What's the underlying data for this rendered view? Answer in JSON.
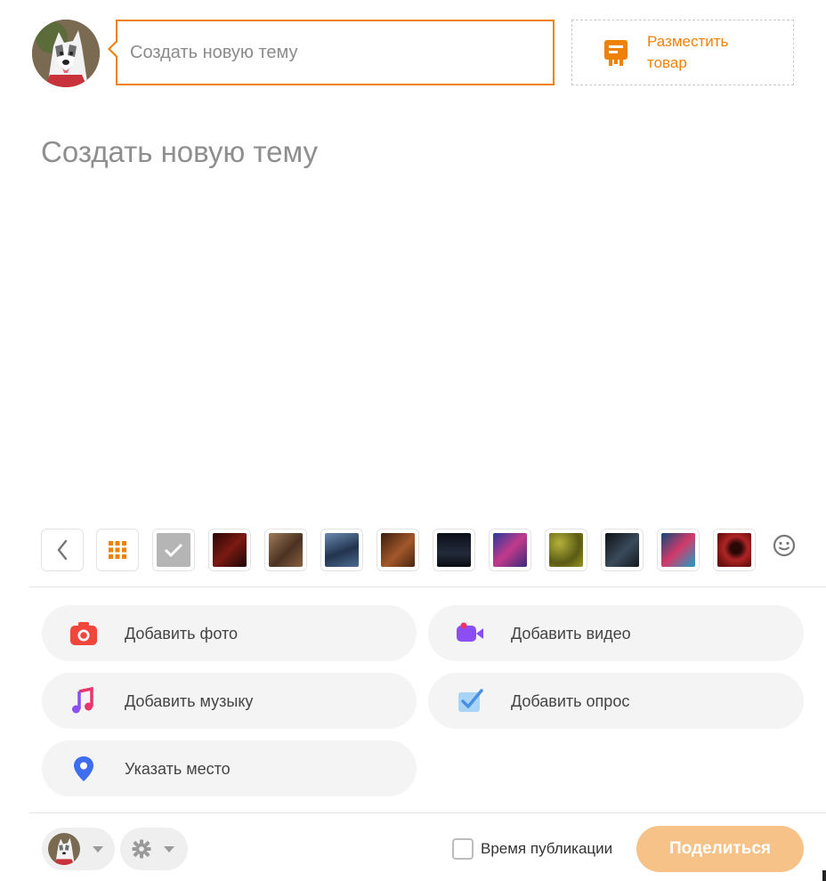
{
  "composer": {
    "input_placeholder": "Создать новую тему",
    "place_product_label": "Разместить товар",
    "title_placeholder": "Создать новую тему"
  },
  "icons": {
    "back": "chevron-left-icon",
    "grid": "grid-icon",
    "check": "check-icon",
    "emoji": "smiley-icon",
    "product": "store-icon",
    "photo": "camera-icon",
    "video": "video-camera-icon",
    "music": "music-note-icon",
    "poll": "poll-check-icon",
    "place": "location-pin-icon",
    "settings": "gear-icon"
  },
  "backgrounds": [
    {
      "name": "dark-red-lava",
      "color": "#4a0d0d"
    },
    {
      "name": "warrior",
      "color": "#7a5a44"
    },
    {
      "name": "soldiers",
      "color": "#3c5a7e"
    },
    {
      "name": "feast",
      "color": "#6b3a1c"
    },
    {
      "name": "suit",
      "color": "#111520"
    },
    {
      "name": "neon-city",
      "color": "#5a3aa8"
    },
    {
      "name": "camo",
      "color": "#8c8a2a"
    },
    {
      "name": "cyber-figure",
      "color": "#2a3440"
    },
    {
      "name": "neon-robot",
      "color": "#1f6fa0"
    },
    {
      "name": "red-headphones",
      "color": "#8a1b1b"
    }
  ],
  "actions": {
    "add_photo": "Добавить фото",
    "add_video": "Добавить видео",
    "add_music": "Добавить музыку",
    "add_poll": "Добавить опрос",
    "set_place": "Указать место"
  },
  "footer": {
    "publish_time_label": "Время публикации",
    "share_label": "Поделиться"
  },
  "colors": {
    "accent": "#ee8208",
    "share_disabled": "#f6c288",
    "photo": "#f0463c",
    "video": "#8a4ef2",
    "music": "#e8356a",
    "poll": "#4a90e2",
    "place": "#3f6df0"
  }
}
